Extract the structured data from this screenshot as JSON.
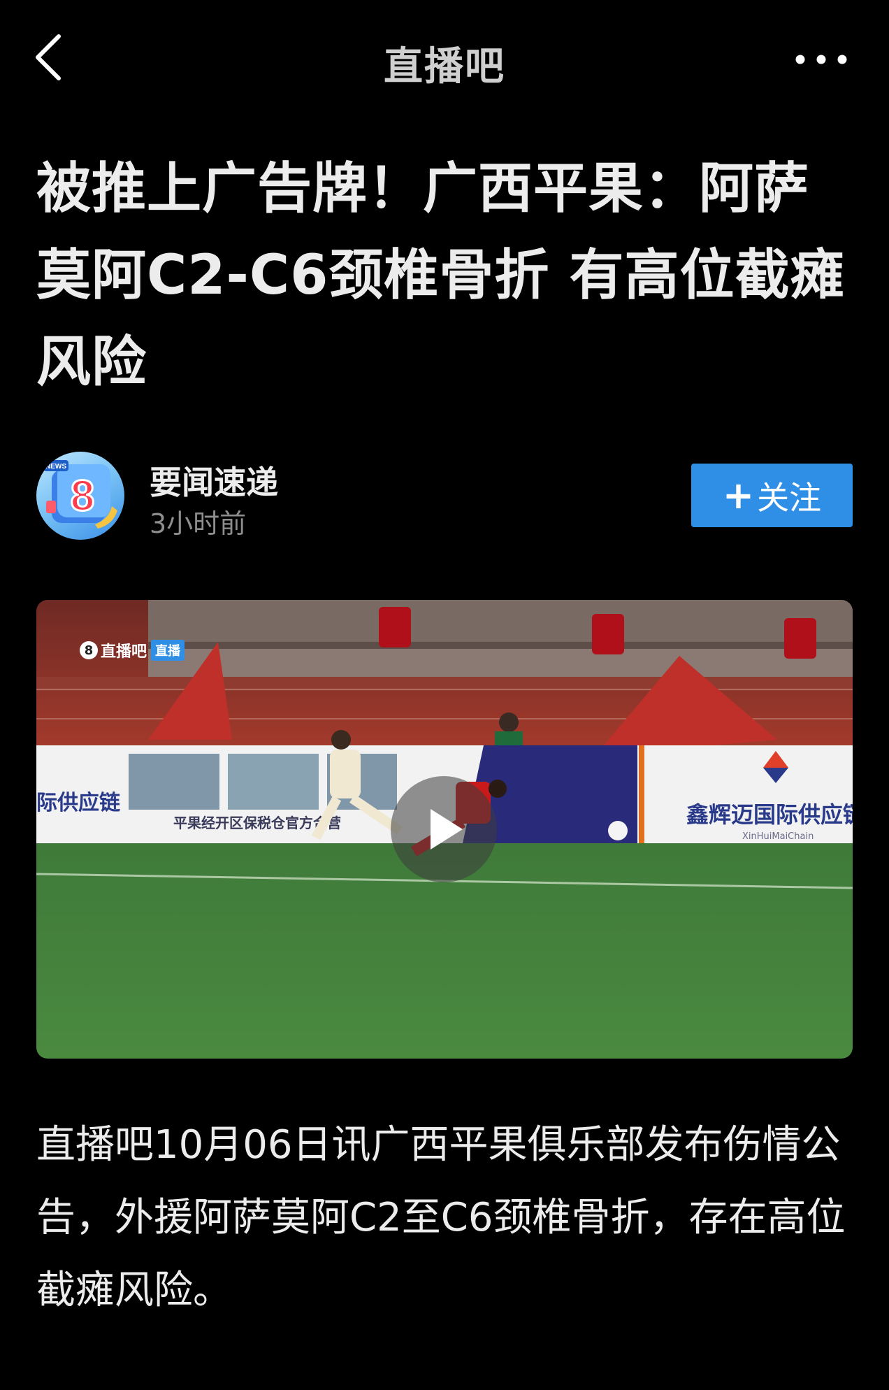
{
  "header": {
    "title": "直播吧",
    "back_icon": "chevron-left-icon",
    "more_icon": "more-horizontal-icon"
  },
  "article": {
    "headline": "被推上广告牌！广西平果：阿萨莫阿C2-C6颈椎骨折 有高位截瘫风险",
    "author": {
      "name": "要闻速递",
      "time": "3小时前",
      "avatar_text": "8",
      "avatar_badge": "NEWS"
    },
    "follow_label": "关注",
    "video": {
      "watermark": "直播吧",
      "watermark_logo": "8",
      "watermark_badge": "直播",
      "board_left": "际供应链",
      "board_mid": "平果经开区保税仓官方合营",
      "board_right": "鑫辉迈国际供应链",
      "board_right_sub": "XinHuiMaiChain"
    },
    "body": "直播吧10月06日讯广西平果俱乐部发布伤情公告，外援阿萨莫阿C2至C6颈椎骨折，存在高位截瘫风险。"
  },
  "colors": {
    "background": "#000000",
    "accent": "#2f8fe6",
    "text_primary": "#ececec",
    "text_secondary": "#8e8e8e"
  }
}
